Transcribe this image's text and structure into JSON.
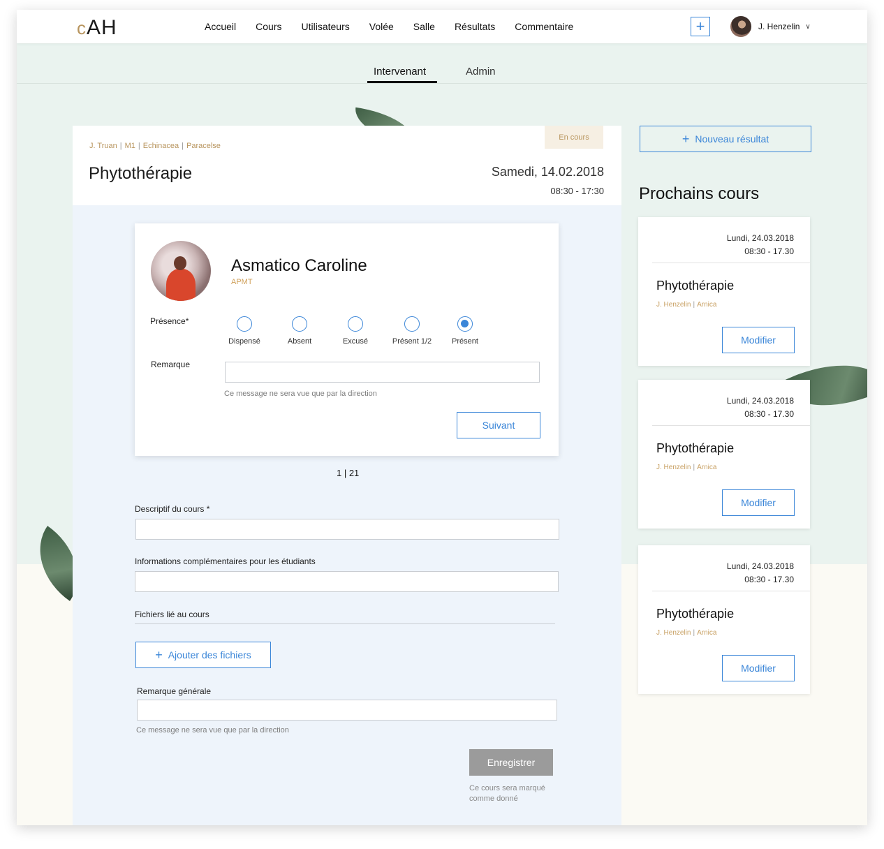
{
  "brand": {
    "logo_c": "c",
    "logo_rest": "AH",
    "accent": "#b8955e",
    "primary": "#3b86d8"
  },
  "nav": {
    "items": [
      "Accueil",
      "Cours",
      "Utilisateurs",
      "Volée",
      "Salle",
      "Résultats",
      "Commentaire"
    ]
  },
  "user": {
    "name": "J. Henzelin"
  },
  "tabs": {
    "active": "Intervenant",
    "other": "Admin"
  },
  "course": {
    "breadcrumb": [
      "J. Truan",
      "M1",
      "Echinacea",
      "Paracelse"
    ],
    "title": "Phytothérapie",
    "status": "En cours",
    "date": "Samedi, 14.02.2018",
    "time": "08:30 - 17:30"
  },
  "student": {
    "name": "Asmatico Caroline",
    "group": "APMT",
    "presence_label": "Présence*",
    "options": [
      "Dispensé",
      "Absent",
      "Excusé",
      "Présent 1/2",
      "Présent"
    ],
    "selected": "Présent",
    "remark_label": "Remarque",
    "remark_value": "",
    "remark_hint": "Ce message ne sera vue que par la direction",
    "next_button": "Suivant"
  },
  "pager": "1 | 21",
  "form": {
    "descriptif_label": "Descriptif du cours *",
    "descriptif_value": "",
    "infos_label": "Informations complémentaires pour les étudiants",
    "infos_value": "",
    "files_label": "Fichiers lié au cours",
    "add_files": "Ajouter des fichiers",
    "general_label": "Remarque générale",
    "general_value": "",
    "general_hint": "Ce message ne sera vue que par la direction",
    "save": "Enregistrer",
    "save_hint": "Ce cours sera marqué comme donné"
  },
  "side": {
    "new_result": "Nouveau résultat",
    "title": "Prochains cours",
    "courses": [
      {
        "date": "Lundi, 24.03.2018",
        "time": "08:30 - 17.30",
        "title": "Phytothérapie",
        "teacher": "J. Henzelin",
        "group": "Arnica",
        "button": "Modifier"
      },
      {
        "date": "Lundi, 24.03.2018",
        "time": "08:30 - 17.30",
        "title": "Phytothérapie",
        "teacher": "J. Henzelin",
        "group": "Arnica",
        "button": "Modifier"
      },
      {
        "date": "Lundi, 24.03.2018",
        "time": "08:30 - 17.30",
        "title": "Phytothérapie",
        "teacher": "J. Henzelin",
        "group": "Arnica",
        "button": "Modifier"
      }
    ]
  }
}
